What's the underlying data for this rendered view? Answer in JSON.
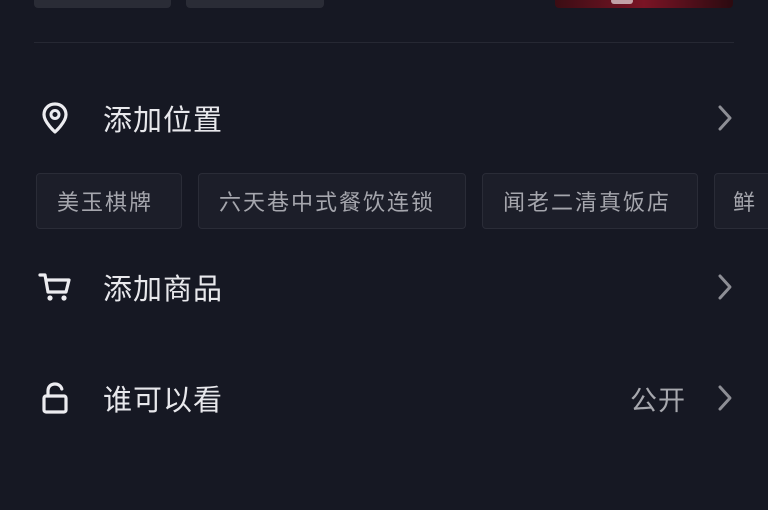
{
  "location_row": {
    "label": "添加位置",
    "icon": "location-pin-icon"
  },
  "location_suggestions": [
    "美玉棋牌",
    "六天巷中式餐饮连锁",
    "闻老二清真饭店",
    "鲜"
  ],
  "product_row": {
    "label": "添加商品",
    "icon": "shopping-cart-icon"
  },
  "visibility_row": {
    "label": "谁可以看",
    "value": "公开",
    "icon": "unlock-icon"
  },
  "colors": {
    "background": "#161823",
    "text_primary": "#e8e8ec",
    "text_secondary": "#a7a8ae",
    "tag_background": "#1c1e29"
  }
}
